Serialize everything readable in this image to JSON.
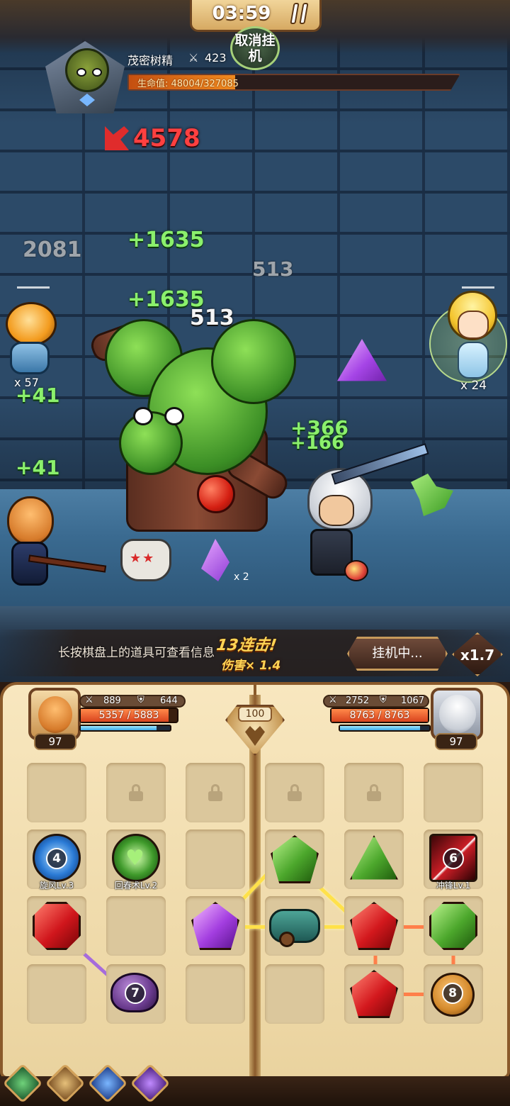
{
  "hud": {
    "timer": "03:59",
    "cancel_auto": "取消挂机"
  },
  "boss": {
    "name": "茂密树精",
    "attack": "423",
    "hp_label": "生命值: 48004/327085",
    "hp_current": 48004,
    "hp_max": 327085
  },
  "floating_numbers": {
    "crit": "4578",
    "heal_top": "+1635",
    "heal_mid": "+1635",
    "grey_left": "2081",
    "grey_mid": "513",
    "white_mid": "513",
    "heal_right_a": "+366",
    "heal_right_b": "+166",
    "heal_left_a": "+41",
    "heal_left_b": "+41"
  },
  "allies": {
    "left_top_mult": "x 57",
    "fairy_mult": "x 24",
    "shard_mult": "x 2"
  },
  "hint": {
    "text": "长按棋盘上的道具可查看信息",
    "combo": "13连击!",
    "combo_damage": "伤害× 1.4"
  },
  "controls": {
    "auto_label": "挂机中...",
    "speed_label": "x1.7"
  },
  "hero_left": {
    "attack": "889",
    "defense": "644",
    "hp_text": "5357 / 5883",
    "hp_fraction": 0.91,
    "mp_fraction": 0.85,
    "level": "97"
  },
  "hero_right": {
    "attack": "2752",
    "defense": "1067",
    "hp_text": "8763 / 8763",
    "hp_fraction": 1.0,
    "mp_fraction": 0.9,
    "level": "97"
  },
  "emblem": {
    "value": "100"
  },
  "board": {
    "skills": [
      {
        "badge": "4",
        "label": "旋风Lv.3"
      },
      {
        "badge": "",
        "label": "回春术Lv.2"
      },
      {
        "badge": "6",
        "label": "冲锋Lv.1"
      }
    ],
    "summon_badges": [
      "7",
      "8"
    ]
  },
  "colors": {
    "link_yellow": "#ffe14a",
    "link_purple": "#a66bdc",
    "link_orange": "#ff7f4a",
    "hp_orange": "#f08a1e"
  }
}
